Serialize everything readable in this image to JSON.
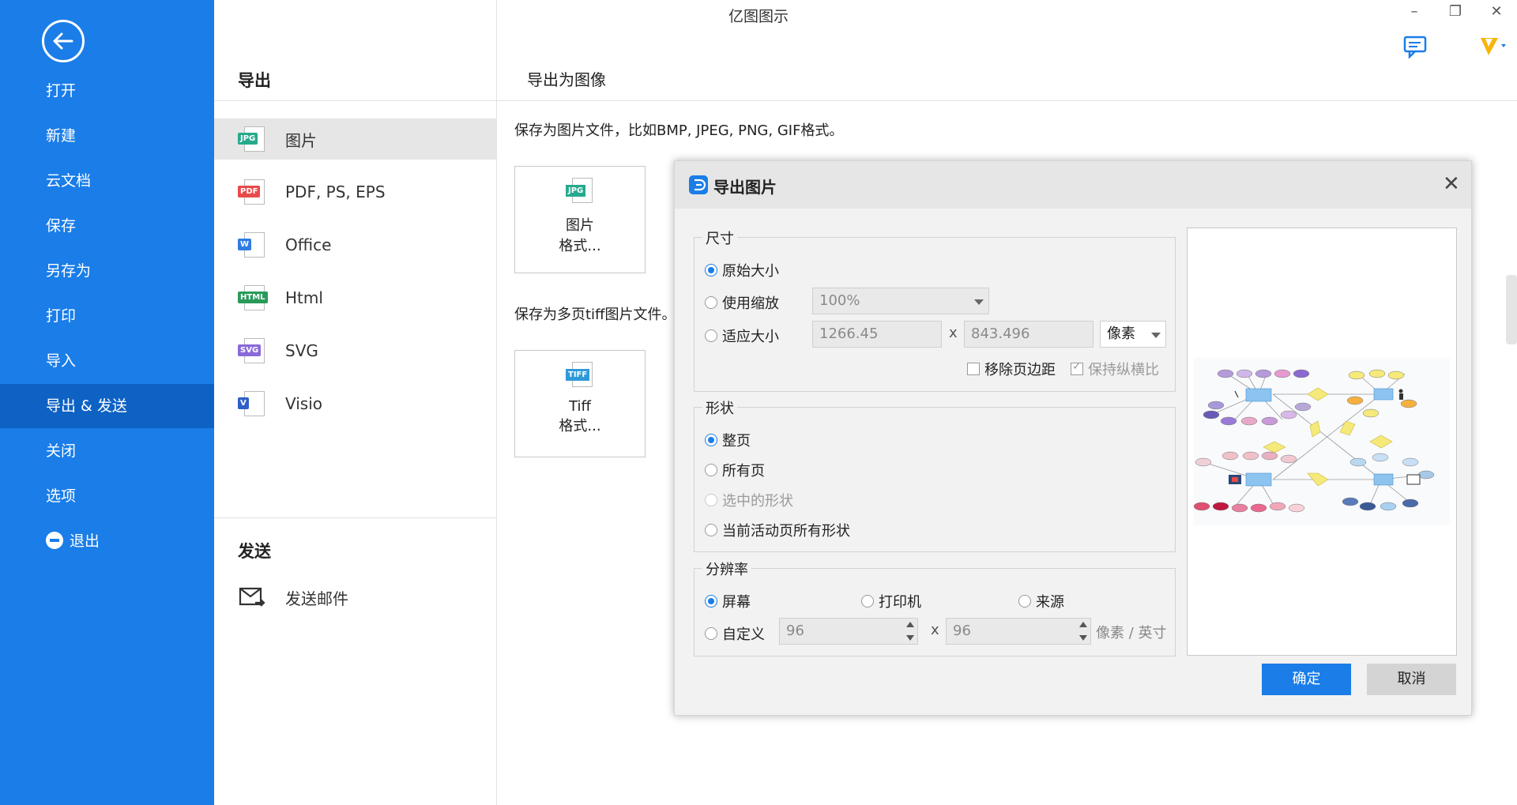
{
  "window": {
    "title": "亿图图示",
    "minimize": "–",
    "restore": "❐",
    "close": "✕"
  },
  "sidebar": {
    "items": [
      {
        "label": "打开"
      },
      {
        "label": "新建"
      },
      {
        "label": "云文档"
      },
      {
        "label": "保存"
      },
      {
        "label": "另存为"
      },
      {
        "label": "打印"
      },
      {
        "label": "导入"
      },
      {
        "label": "导出 & 发送"
      },
      {
        "label": "关闭"
      },
      {
        "label": "选项"
      },
      {
        "label": "退出"
      }
    ],
    "active_index": 7
  },
  "middle": {
    "export_title": "导出",
    "formats": [
      {
        "label": "图片",
        "tag": "JPG",
        "color": "#27a98d"
      },
      {
        "label": "PDF, PS, EPS",
        "tag": "PDF",
        "color": "#e84a4a"
      },
      {
        "label": "Office",
        "tag": "W",
        "color": "#2f7de1"
      },
      {
        "label": "Html",
        "tag": "HTML",
        "color": "#2a9a5a"
      },
      {
        "label": "SVG",
        "tag": "SVG",
        "color": "#8a6ad8"
      },
      {
        "label": "Visio",
        "tag": "V",
        "color": "#2f5fc8"
      }
    ],
    "send_title": "发送",
    "send_items": [
      {
        "label": "发送邮件"
      }
    ]
  },
  "content": {
    "heading": "导出为图像",
    "desc1": "保存为图片文件，比如BMP, JPEG, PNG, GIF格式。",
    "btn1_line1": "图片",
    "btn1_line2": "格式...",
    "btn1_tag": "JPG",
    "desc2": "保存为多页tiff图片文件。",
    "btn2_line1": "Tiff",
    "btn2_line2": "格式...",
    "btn2_tag": "TIFF"
  },
  "dialog": {
    "title": "导出图片",
    "size_group": "尺寸",
    "opt_original": "原始大小",
    "opt_zoom": "使用缩放",
    "zoom_value": "100%",
    "opt_fit": "适应大小",
    "fit_width": "1266.45",
    "fit_height": "843.496",
    "x": "x",
    "unit": "像素",
    "remove_margin": "移除页边距",
    "keep_ratio": "保持纵横比",
    "shape_group": "形状",
    "opt_whole_page": "整页",
    "opt_all_pages": "所有页",
    "opt_selected": "选中的形状",
    "opt_current_page_shapes": "当前活动页所有形状",
    "res_group": "分辨率",
    "opt_screen": "屏幕",
    "opt_printer": "打印机",
    "opt_source": "来源",
    "opt_custom": "自定义",
    "dpi_x": "96",
    "dpi_y": "96",
    "dpi_unit": "像素 / 英寸",
    "ok": "确定",
    "cancel": "取消"
  },
  "colors": {
    "accent": "#1a7de8",
    "sidebar_active": "#0d62c4"
  }
}
